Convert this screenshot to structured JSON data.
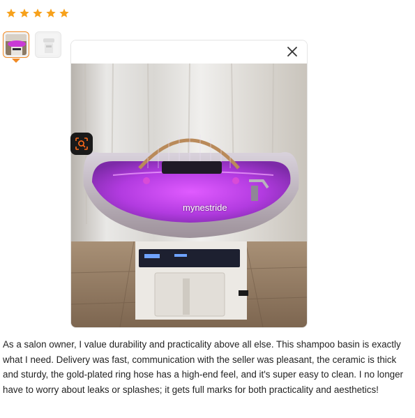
{
  "rating": {
    "stars": 5,
    "max": 5,
    "color": "#f7a11b"
  },
  "thumbnails": [
    {
      "name": "thumbnail-1",
      "selected": true,
      "icon": "photo-thumbnail-purple-basin"
    },
    {
      "name": "thumbnail-2",
      "selected": false,
      "icon": "photo-thumbnail-white-basin"
    }
  ],
  "viewer": {
    "close_icon": "close-icon",
    "watermark": "mynestride",
    "lens_icon": "image-search-icon"
  },
  "review": {
    "text": "As a salon owner, I value durability and practicality above all else. This shampoo basin is exactly what I need. Delivery was fast, communication with the seller was pleasant, the ceramic is thick and sturdy, the gold-plated ring hose has a high-end feel, and it's super easy to clean. I no longer have to worry about leaks or splashes; it gets full marks for both practicality and aesthetics!"
  }
}
